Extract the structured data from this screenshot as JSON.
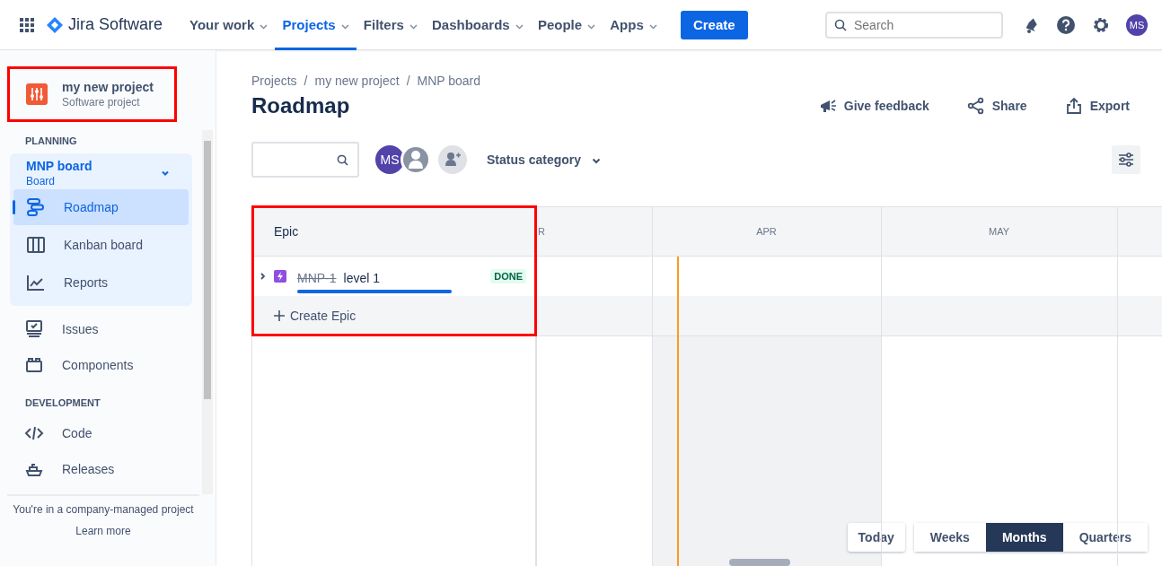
{
  "nav": {
    "app_name": "Jira Software",
    "items": [
      {
        "label": "Your work",
        "selected": false
      },
      {
        "label": "Projects",
        "selected": true
      },
      {
        "label": "Filters",
        "selected": false
      },
      {
        "label": "Dashboards",
        "selected": false
      },
      {
        "label": "People",
        "selected": false
      },
      {
        "label": "Apps",
        "selected": false
      }
    ],
    "create": "Create",
    "search": {
      "placeholder": "Search"
    },
    "avatar": "MS"
  },
  "sidebar": {
    "project": {
      "name": "my new project",
      "type": "Software project",
      "highlighted": true
    },
    "planning": {
      "heading": "PLANNING",
      "board": {
        "name": "MNP board",
        "subtitle": "Board",
        "expanded": true,
        "items": [
          {
            "label": "Roadmap",
            "selected": true
          },
          {
            "label": "Kanban board",
            "selected": false
          },
          {
            "label": "Reports",
            "selected": false
          }
        ]
      },
      "items": [
        {
          "label": "Issues",
          "selected": false
        },
        {
          "label": "Components",
          "selected": false
        }
      ]
    },
    "development": {
      "heading": "DEVELOPMENT",
      "items": [
        {
          "label": "Code",
          "selected": false
        },
        {
          "label": "Releases",
          "selected": false
        }
      ]
    },
    "footer": {
      "text": "You're in a company-managed project",
      "link": "Learn more"
    }
  },
  "main": {
    "breadcrumbs": [
      {
        "label": "Projects"
      },
      {
        "separator": "/",
        "label": "my new project"
      },
      {
        "separator": "/",
        "label": "MNP board"
      }
    ],
    "title": "Roadmap",
    "actions": [
      "Give feedback",
      "Share",
      "Export"
    ],
    "filters": {
      "avatars": [
        "MS"
      ],
      "status": "Status category"
    },
    "timeline": {
      "highlighted": true,
      "epic_header": "Epic",
      "epics": [
        {
          "key": "MNP-1",
          "title": "level 1",
          "status": "DONE",
          "done": true,
          "expanded": false,
          "level": 1
        }
      ],
      "create": "Create Epic",
      "months": [
        {
          "label": "R",
          "current": false
        },
        {
          "label": "APR",
          "current": true
        },
        {
          "label": "MAY",
          "current": false
        }
      ]
    },
    "today": "Today",
    "scales": [
      {
        "label": "Weeks",
        "selected": false
      },
      {
        "label": "Months",
        "selected": true
      },
      {
        "label": "Quarters",
        "selected": false
      }
    ]
  }
}
